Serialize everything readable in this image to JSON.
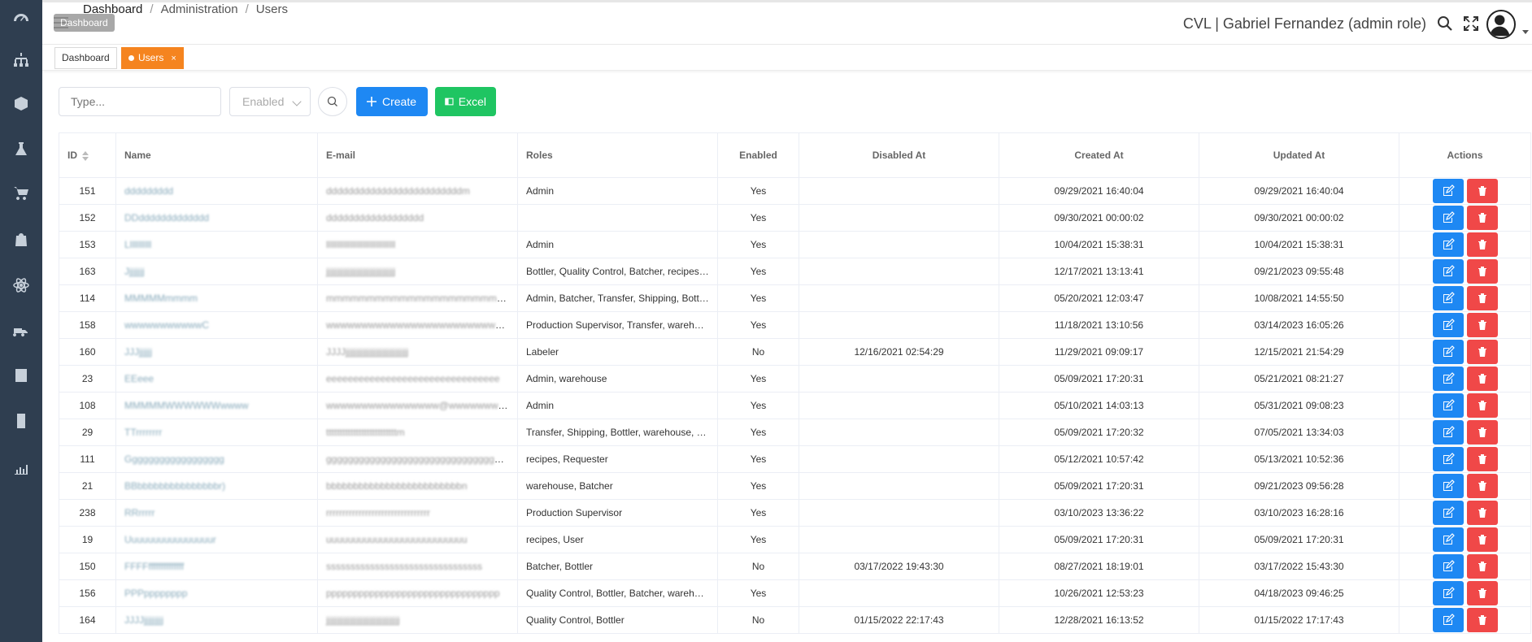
{
  "sidebar": {
    "items": [
      {
        "name": "dashboard-icon"
      },
      {
        "name": "hierarchy-icon"
      },
      {
        "name": "box-icon"
      },
      {
        "name": "flask-icon"
      },
      {
        "name": "cart-icon"
      },
      {
        "name": "bag-icon"
      },
      {
        "name": "atom-icon"
      },
      {
        "name": "truck-icon"
      },
      {
        "name": "report-icon"
      },
      {
        "name": "building-icon"
      },
      {
        "name": "chart-icon"
      }
    ]
  },
  "header": {
    "tooltip": "Dashboard",
    "breadcrumb": [
      "Dashboard",
      "Administration",
      "Users"
    ],
    "user_title": "CVL | Gabriel Fernandez (admin role)"
  },
  "tabs": [
    {
      "label": "Dashboard",
      "active": false
    },
    {
      "label": "Users",
      "active": true,
      "close": "×"
    }
  ],
  "toolbar": {
    "search_placeholder": "Type...",
    "status_select": "Enabled",
    "create_label": "Create",
    "excel_label": "Excel"
  },
  "colors": {
    "sidebar": "#2f3e50",
    "active_tab": "#f5841f",
    "create": "#1e88f3",
    "excel": "#1fc562",
    "delete": "#f04848"
  },
  "table": {
    "columns": [
      "ID",
      "Name",
      "E-mail",
      "Roles",
      "Enabled",
      "Disabled At",
      "Created At",
      "Updated At",
      "Actions"
    ],
    "rows": [
      {
        "id": "151",
        "name": "ddddddddd",
        "email": "dddddddddddddddddddddddddm",
        "roles": "Admin",
        "enabled": "Yes",
        "disabled": "",
        "created": "09/29/2021 16:40:04",
        "updated": "09/29/2021 16:40:04"
      },
      {
        "id": "152",
        "name": "DDddddddddddddd",
        "email": "dddddddddddddddddd",
        "roles": "",
        "enabled": "Yes",
        "disabled": "",
        "created": "09/30/2021 00:00:02",
        "updated": "09/30/2021 00:00:02"
      },
      {
        "id": "153",
        "name": "Lllllllllll",
        "email": "llllllllllllllllllllllllllllllll",
        "roles": "Admin",
        "enabled": "Yes",
        "disabled": "",
        "created": "10/04/2021 15:38:31",
        "updated": "10/04/2021 15:38:31"
      },
      {
        "id": "163",
        "name": "Jjjjjjjj",
        "email": "jjjjjjjjjjjjjjjjjjjjjjjjjjjjjjjj",
        "roles": "Bottler, Quality Control, Batcher, recipes, warehouse",
        "enabled": "Yes",
        "disabled": "",
        "created": "12/17/2021 13:13:41",
        "updated": "09/21/2023 09:55:48"
      },
      {
        "id": "114",
        "name": "MMMMMmmmm",
        "email": "mmmmmmmmmmmmmmmmmmmmmmm",
        "roles": "Admin, Batcher, Transfer, Shipping, Bottler",
        "enabled": "Yes",
        "disabled": "",
        "created": "05/20/2021 12:03:47",
        "updated": "10/08/2021 14:55:50"
      },
      {
        "id": "158",
        "name": "wwwwwwwwwwwC",
        "email": "wwwwwwwwwwwwwwwwwwwwwwwwwwwwwwwww",
        "roles": "Production Supervisor, Transfer, warehouse",
        "enabled": "Yes",
        "disabled": "",
        "created": "11/18/2021 13:10:56",
        "updated": "03/14/2023 16:05:26"
      },
      {
        "id": "160",
        "name": "JJJjjjjjj",
        "email": "JJJJjjjjjjjjjjjjjjjjjjjjjjjjjjjjj",
        "roles": "Labeler",
        "enabled": "No",
        "disabled": "12/16/2021 02:54:29",
        "created": "11/29/2021 09:09:17",
        "updated": "12/15/2021 21:54:29"
      },
      {
        "id": "23",
        "name": "EEeee",
        "email": "eeeeeeeeeeeeeeeeeeeeeeeeeeeeeeee",
        "roles": "Admin, warehouse",
        "enabled": "Yes",
        "disabled": "",
        "created": "05/09/2021 17:20:31",
        "updated": "05/21/2021 08:21:27"
      },
      {
        "id": "108",
        "name": "MMMMMWWWWWWwwww",
        "email": "wwwwwwwwwwwwwwww@wwwwwwwwww",
        "roles": "Admin",
        "enabled": "Yes",
        "disabled": "",
        "created": "05/10/2021 14:03:13",
        "updated": "05/31/2021 09:08:23"
      },
      {
        "id": "29",
        "name": "TTrrrrrrrr",
        "email": "ttttttttttttttttttttttttttm",
        "roles": "Transfer, Shipping, Bottler, warehouse, recipes",
        "enabled": "Yes",
        "disabled": "",
        "created": "05/09/2021 17:20:32",
        "updated": "07/05/2021 13:34:03"
      },
      {
        "id": "111",
        "name": "Gggggggggggggggggg",
        "email": "gggggggggggggggggggggggggggggggggg",
        "roles": "recipes, Requester",
        "enabled": "Yes",
        "disabled": "",
        "created": "05/12/2021 10:57:42",
        "updated": "05/13/2021 10:52:36"
      },
      {
        "id": "21",
        "name": "BBbbbbbbbbbbbbbbbr)",
        "email": "bbbbbbbbbbbbbbbbbbbbbbbbbn",
        "roles": "warehouse, Batcher",
        "enabled": "Yes",
        "disabled": "",
        "created": "05/09/2021 17:20:31",
        "updated": "09/21/2023 09:56:28"
      },
      {
        "id": "238",
        "name": "RRrrrrr",
        "email": "rrrrrrrrrrrrrrrrrrrrrrrrrrrrrrrr",
        "roles": "Production Supervisor",
        "enabled": "Yes",
        "disabled": "",
        "created": "03/10/2023 13:36:22",
        "updated": "03/10/2023 16:28:16"
      },
      {
        "id": "19",
        "name": "Uuuuuuuuuuuuuuuur",
        "email": "uuuuuuuuuuuuuuuuuuuuuuuuuu",
        "roles": "recipes, User",
        "enabled": "Yes",
        "disabled": "",
        "created": "05/09/2021 17:20:31",
        "updated": "05/09/2021 17:20:31"
      },
      {
        "id": "150",
        "name": "FFFFffffffffffffff",
        "email": "ssssssssssssssssssssssssssssssss",
        "roles": "Batcher, Bottler",
        "enabled": "No",
        "disabled": "03/17/2022 19:43:30",
        "created": "08/27/2021 18:19:01",
        "updated": "03/17/2022 15:43:30"
      },
      {
        "id": "156",
        "name": "PPPpppppppp",
        "email": "pppppppppppppppppppppppppppppppp",
        "roles": "Quality Control, Bottler, Batcher, warehouse",
        "enabled": "Yes",
        "disabled": "",
        "created": "10/26/2021 12:53:23",
        "updated": "04/18/2023 09:46:25"
      },
      {
        "id": "164",
        "name": "JJJJjjjjjjjjj",
        "email": "jjjjjjjjjjjjjjjjjjjjjjjjjjjjjjjjjj",
        "roles": "Quality Control, Bottler",
        "enabled": "No",
        "disabled": "01/15/2022 22:17:43",
        "created": "12/28/2021 16:13:52",
        "updated": "01/15/2022 17:17:43"
      }
    ]
  }
}
